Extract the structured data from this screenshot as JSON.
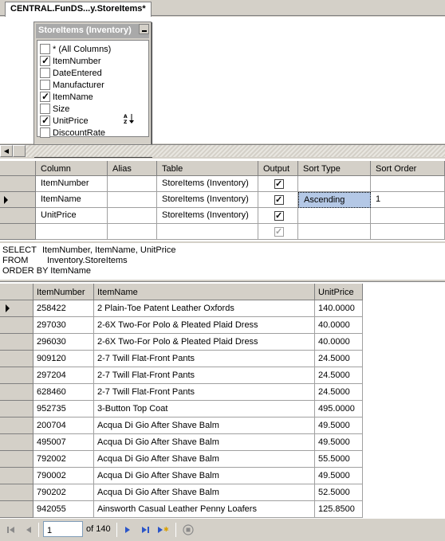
{
  "window": {
    "tab_title": "CENTRAL.FunDS...y.StoreItems*"
  },
  "diagram": {
    "table_title": "StoreItems (Inventory)",
    "columns": [
      {
        "label": "* (All Columns)",
        "checked": false
      },
      {
        "label": "ItemNumber",
        "checked": true
      },
      {
        "label": "DateEntered",
        "checked": false
      },
      {
        "label": "Manufacturer",
        "checked": false
      },
      {
        "label": "ItemName",
        "checked": true
      },
      {
        "label": "Size",
        "checked": false
      },
      {
        "label": "UnitPrice",
        "checked": true
      },
      {
        "label": "DiscountRate",
        "checked": false
      }
    ],
    "sort_icon": "sort-ascending-az-icon"
  },
  "criteria": {
    "headers": [
      "Column",
      "Alias",
      "Table",
      "Output",
      "Sort Type",
      "Sort Order"
    ],
    "rows": [
      {
        "column": "ItemNumber",
        "alias": "",
        "table": "StoreItems (Inventory)",
        "output": true,
        "sort_type": "",
        "sort_order": ""
      },
      {
        "column": "ItemName",
        "alias": "",
        "table": "StoreItems (Inventory)",
        "output": true,
        "sort_type": "Ascending",
        "sort_order": "1"
      },
      {
        "column": "UnitPrice",
        "alias": "",
        "table": "StoreItems (Inventory)",
        "output": true,
        "sort_type": "",
        "sort_order": ""
      },
      {
        "column": "",
        "alias": "",
        "table": "",
        "output": true,
        "sort_type": "",
        "sort_order": ""
      }
    ]
  },
  "sql": {
    "select_kw": "SELECT",
    "select_text": "ItemNumber, ItemName, UnitPrice",
    "from_kw": "FROM",
    "from_text": "Inventory.StoreItems",
    "order_line": "ORDER BY ItemName"
  },
  "results": {
    "headers": [
      "ItemNumber",
      "ItemName",
      "UnitPrice"
    ],
    "rows": [
      [
        "258422",
        "2 Plain-Toe Patent Leather Oxfords",
        "140.0000"
      ],
      [
        "297030",
        "2-6X Two-For Polo & Pleated Plaid Dress",
        "40.0000"
      ],
      [
        "296030",
        "2-6X Two-For Polo & Pleated Plaid Dress",
        "40.0000"
      ],
      [
        "909120",
        "2-7 Twill Flat-Front Pants",
        "24.5000"
      ],
      [
        "297204",
        "2-7 Twill Flat-Front Pants",
        "24.5000"
      ],
      [
        "628460",
        "2-7 Twill Flat-Front Pants",
        "24.5000"
      ],
      [
        "952735",
        "3-Button Top Coat",
        "495.0000"
      ],
      [
        "200704",
        "Acqua Di Gio After Shave Balm",
        "49.5000"
      ],
      [
        "495007",
        "Acqua Di Gio After Shave Balm",
        "49.5000"
      ],
      [
        "792002",
        "Acqua Di Gio After Shave Balm",
        "55.5000"
      ],
      [
        "790002",
        "Acqua Di Gio After Shave Balm",
        "49.5000"
      ],
      [
        "790202",
        "Acqua Di Gio After Shave Balm",
        "52.5000"
      ],
      [
        "942055",
        "Ainsworth Casual Leather Penny Loafers",
        "125.8500"
      ]
    ]
  },
  "navigator": {
    "current_record": "1",
    "of_label": "of 140"
  }
}
